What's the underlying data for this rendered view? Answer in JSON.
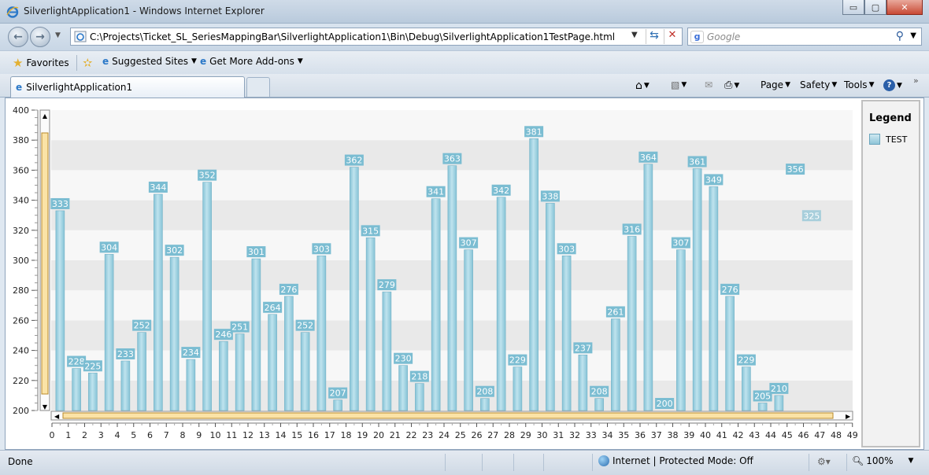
{
  "window": {
    "title": "SilverlightApplication1 - Windows Internet Explorer",
    "minimize": "▭",
    "restore": "▢",
    "close": "✕"
  },
  "navbar": {
    "url": "C:\\Projects\\Ticket_SL_SeriesMappingBar\\SilverlightApplication1\\Bin\\Debug\\SilverlightApplication1TestPage.html",
    "search_placeholder": "Google"
  },
  "favorites": {
    "favorites_label": "Favorites",
    "suggested_label": "Suggested Sites",
    "addons_label": "Get More Add-ons"
  },
  "tab": {
    "label": "SilverlightApplication1"
  },
  "commands": {
    "page": "Page",
    "safety": "Safety",
    "tools": "Tools"
  },
  "legend": {
    "title": "Legend",
    "item": "TEST"
  },
  "status": {
    "left": "Done",
    "zone": "Internet | Protected Mode: Off",
    "zoom": "100%"
  },
  "colors": {
    "bar_top": "#bfe3ee",
    "bar_bottom": "#86c3d6",
    "label_bg": "#7bbdd2",
    "stripe": "#e9e9e9"
  },
  "chart_data": {
    "type": "bar",
    "categories": [
      0,
      1,
      2,
      3,
      4,
      5,
      6,
      7,
      8,
      9,
      10,
      11,
      12,
      13,
      14,
      15,
      16,
      17,
      18,
      19,
      20,
      21,
      22,
      23,
      24,
      25,
      26,
      27,
      28,
      29,
      30,
      31,
      32,
      33,
      34,
      35,
      36,
      37,
      38,
      39,
      40,
      41,
      42,
      43,
      44,
      45,
      46,
      47,
      48,
      49
    ],
    "series": [
      {
        "name": "TEST",
        "values": [
          333,
          228,
          225,
          304,
          233,
          252,
          344,
          302,
          234,
          352,
          246,
          251,
          301,
          264,
          276,
          252,
          303,
          207,
          362,
          315,
          279,
          230,
          218,
          341,
          363,
          307,
          208,
          342,
          229,
          381,
          338,
          303,
          237,
          208,
          261,
          316,
          364,
          200,
          307,
          361,
          349,
          276,
          229,
          205,
          210,
          356,
          325,
          null,
          null,
          null
        ]
      }
    ],
    "ylim": [
      200,
      400
    ],
    "yticks": [
      200,
      220,
      240,
      260,
      280,
      300,
      320,
      340,
      360,
      380,
      400
    ],
    "grid": "horizontal stripes",
    "legend_position": "right"
  }
}
